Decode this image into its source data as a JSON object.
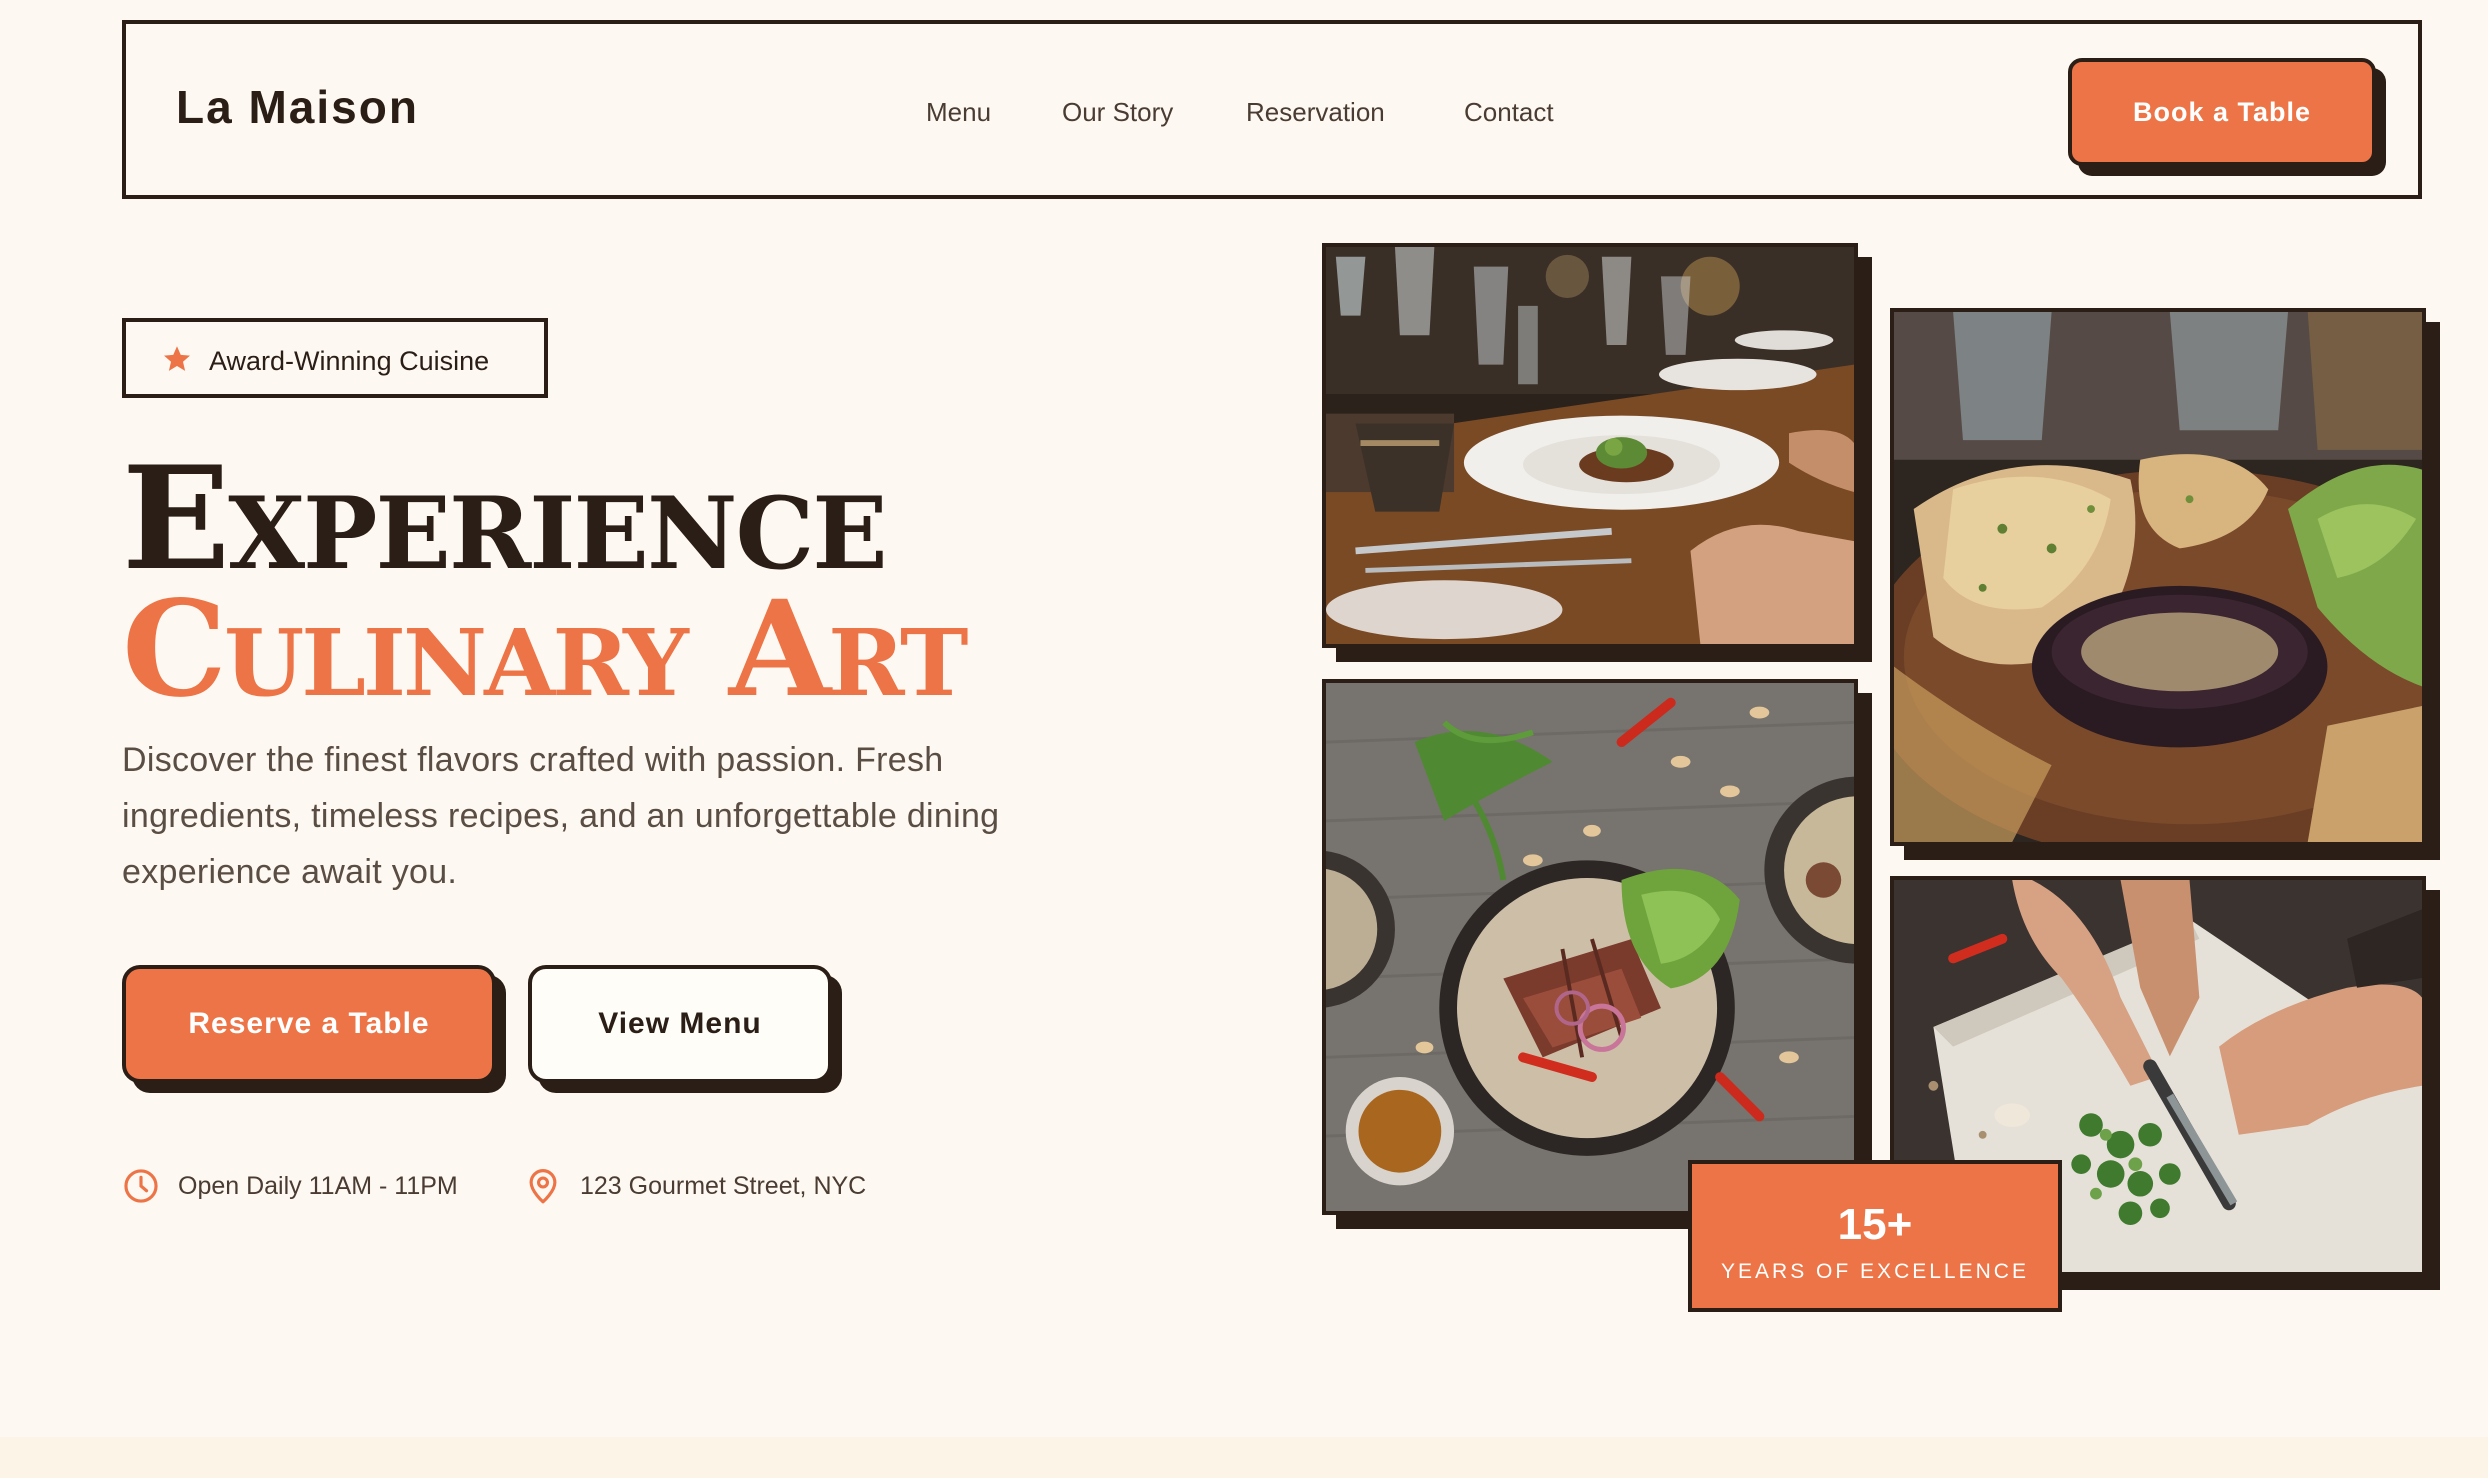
{
  "brand": {
    "logo": "La Maison"
  },
  "nav": {
    "links": [
      "Menu",
      "Our Story",
      "Reservation",
      "Contact"
    ],
    "cta": "Book a Table"
  },
  "hero": {
    "badge": "Award-Winning Cuisine",
    "title_line1": "Experience",
    "title_line2": "Culinary Art",
    "description": "Discover the finest flavors crafted with passion. Fresh ingredients, timeless recipes, and an unforgettable dining experience await you.",
    "primary_button": "Reserve a Table",
    "secondary_button": "View Menu",
    "hours": "Open Daily 11AM - 11PM",
    "address": "123 Gourmet Street, NYC"
  },
  "stat": {
    "number": "15+",
    "label": "YEARS OF EXCELLENCE"
  },
  "gallery": [
    {
      "subject": "fine dining table with wine glasses and plated dish"
    },
    {
      "subject": "grilled seafood platter with dipping sauce"
    },
    {
      "subject": "sliced steak bowl with greens, chili and cashews"
    },
    {
      "subject": "chef chopping herbs on cutting board"
    }
  ],
  "colors": {
    "accent": "#ed7446",
    "dark": "#2a1e17",
    "background": "#fdf9f2"
  },
  "icons": {
    "badge": "star-icon",
    "hours": "clock-icon",
    "address": "map-pin-icon"
  }
}
